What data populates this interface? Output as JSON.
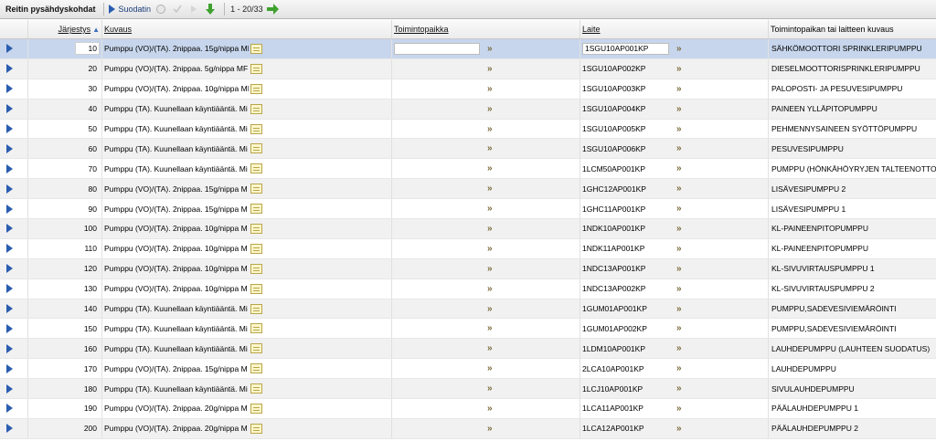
{
  "toolbar": {
    "title": "Reitin pysähdyskohdat",
    "filter_label": "Suodatin",
    "count": "1 - 20/33",
    "colors": {
      "link": "#1a3d7a",
      "green": "#3ea12e"
    }
  },
  "columns": {
    "order": "Järjestys",
    "description": "Kuvaus",
    "function_location": "Toimintopaikka",
    "device": "Laite",
    "long_description": "Toimintopaikan tai laitteen kuvaus"
  },
  "rows": [
    {
      "order": "10",
      "description": "Pumppu (VO)/(TA). 2nippaa. 15g/nippa MF",
      "device": "1SGU10AP001KP",
      "long": "SÄHKÖMOOTTORI SPRINKLERIPUMPPU"
    },
    {
      "order": "20",
      "description": "Pumppu (VO)/(TA). 2nippaa. 5g/nippa MF",
      "device": "1SGU10AP002KP",
      "long": "DIESELMOOTTORISPRINKLERIPUMPPU"
    },
    {
      "order": "30",
      "description": "Pumppu (VO)/(TA). 2nippaa. 10g/nippa MF",
      "device": "1SGU10AP003KP",
      "long": "PALOPOSTI- JA PESUVESIPUMPPU"
    },
    {
      "order": "40",
      "description": "Pumppu (TA). Kuunellaan käyntiääntä. Mi",
      "device": "1SGU10AP004KP",
      "long": "PAINEEN YLLÄPITOPUMPPU"
    },
    {
      "order": "50",
      "description": "Pumppu (TA). Kuunellaan käyntiääntä. Mi",
      "device": "1SGU10AP005KP",
      "long": "PEHMENNYSAINEEN SYÖTTÖPUMPPU"
    },
    {
      "order": "60",
      "description": "Pumppu (TA). Kuunellaan käyntiääntä. Mi",
      "device": "1SGU10AP006KP",
      "long": "PESUVESIPUMPPU"
    },
    {
      "order": "70",
      "description": "Pumppu (TA). Kuunellaan käyntiääntä. Mi",
      "device": "1LCM50AP001KP",
      "long": "PUMPPU  (HÖNKÄHÖYRYJEN TALTEENOTTO)"
    },
    {
      "order": "80",
      "description": "Pumppu (VO)/(TA). 2nippaa. 15g/nippa M",
      "device": "1GHC12AP001KP",
      "long": "LISÄVESIPUMPPU 2"
    },
    {
      "order": "90",
      "description": "Pumppu (VO)/(TA). 2nippaa. 15g/nippa M",
      "device": "1GHC11AP001KP",
      "long": "LISÄVESIPUMPPU 1"
    },
    {
      "order": "100",
      "description": "Pumppu (VO)/(TA). 2nippaa. 10g/nippa M",
      "device": "1NDK10AP001KP",
      "long": "KL-PAINEENPITOPUMPPU"
    },
    {
      "order": "110",
      "description": "Pumppu (VO)/(TA). 2nippaa. 10g/nippa M",
      "device": "1NDK11AP001KP",
      "long": "KL-PAINEENPITOPUMPPU"
    },
    {
      "order": "120",
      "description": "Pumppu (VO)/(TA). 2nippaa. 10g/nippa M",
      "device": "1NDC13AP001KP",
      "long": "KL-SIVUVIRTAUSPUMPPU 1"
    },
    {
      "order": "130",
      "description": "Pumppu (VO)/(TA). 2nippaa. 10g/nippa M",
      "device": "1NDC13AP002KP",
      "long": "KL-SIVUVIRTAUSPUMPPU 2"
    },
    {
      "order": "140",
      "description": "Pumppu (TA). Kuunellaan käyntiääntä. Mi",
      "device": "1GUM01AP001KP",
      "long": "PUMPPU,SADEVESIVIEMÄRÖINTI"
    },
    {
      "order": "150",
      "description": "Pumppu (TA). Kuunellaan käyntiääntä. Mi",
      "device": "1GUM01AP002KP",
      "long": "PUMPPU,SADEVESIVIEMÄRÖINTI"
    },
    {
      "order": "160",
      "description": "Pumppu (TA). Kuunellaan käyntiääntä. Mi",
      "device": "1LDM10AP001KP",
      "long": "LAUHDEPUMPPU (LAUHTEEN SUODATUS)"
    },
    {
      "order": "170",
      "description": "Pumppu (VO)/(TA). 2nippaa. 15g/nippa M",
      "device": "2LCA10AP001KP",
      "long": "LAUHDEPUMPPU"
    },
    {
      "order": "180",
      "description": "Pumppu (TA). Kuunellaan käyntiääntä. Mi",
      "device": "1LCJ10AP001KP",
      "long": "SIVULAUHDEPUMPPU"
    },
    {
      "order": "190",
      "description": "Pumppu (VO)/(TA). 2nippaa. 20g/nippa M",
      "device": "1LCA11AP001KP",
      "long": "PÄÄLAUHDEPUMPPU 1"
    },
    {
      "order": "200",
      "description": "Pumppu (VO)/(TA). 2nippaa. 20g/nippa M",
      "device": "1LCA12AP001KP",
      "long": "PÄÄLAUHDEPUMPPU 2"
    }
  ],
  "link_glyph": "»",
  "selected_row_index": 0
}
